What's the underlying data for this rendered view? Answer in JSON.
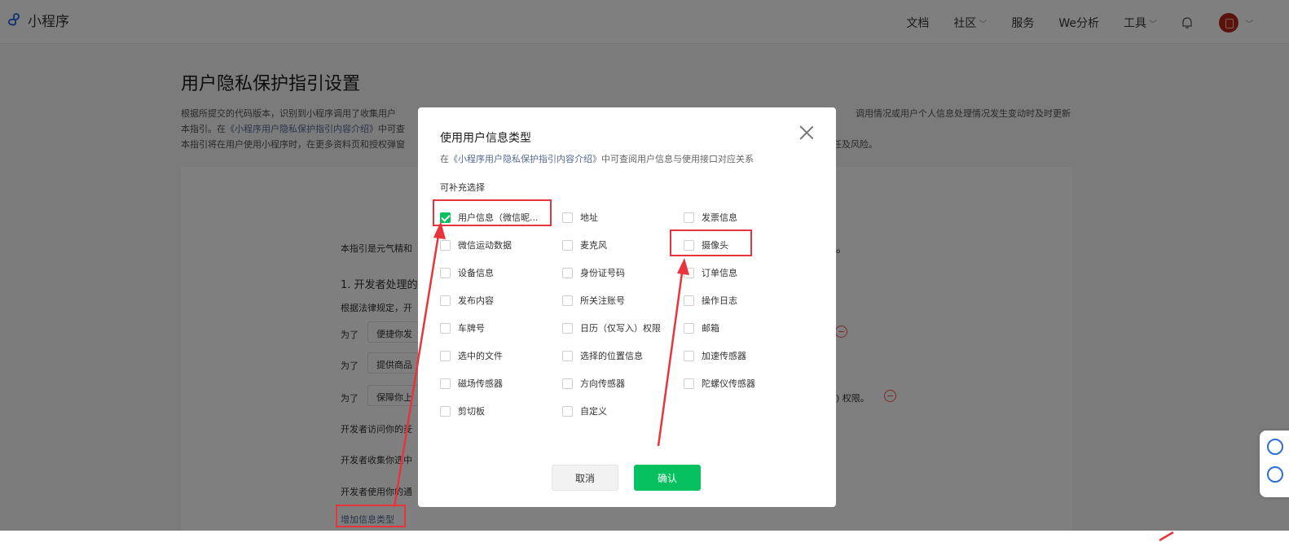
{
  "topbar": {
    "app_name": "小程序",
    "nav": {
      "docs": "文档",
      "community": "社区",
      "services": "服务",
      "we_analysis": "We分析",
      "tools": "工具"
    }
  },
  "page": {
    "title": "用户隐私保护指引设置",
    "desc_1_left": "根据所提交的代码版本，识别到小程序调用了收集用户",
    "desc_1_right": "调用情况或用户个人信息处理情况发生变动时及时更新",
    "desc_2_left": "本指引。在",
    "desc_2_link": "《小程序用户隐私保护指引内容介绍》",
    "desc_2_mid": "中可查",
    "desc_3_left": "本指引将在用户使用小程序时，在更多资料页和授权弹窗",
    "desc_3_right": "任及风险。"
  },
  "background": {
    "intro_left": "本指引是元气精和",
    "intro_right": "。",
    "section_1": "1. 开发者处理的",
    "law_text": "根据法律规定，开",
    "purpose_label": "为了",
    "purpose_1": "便捷你发",
    "purpose_2": "提供商品",
    "purpose_3": "保障你上",
    "purpose_3_suffix": ") 权限。",
    "line_access": "开发者访问你的麦",
    "line_collect": "开发者收集你选中",
    "line_use": "开发者使用你的通",
    "add_type": "增加信息类型"
  },
  "dialog": {
    "title": "使用用户信息类型",
    "hint_prefix": "在",
    "hint_link": "《小程序用户隐私保护指引内容介绍》",
    "hint_suffix": "中可查阅用户信息与使用接口对应关系",
    "section_label": "可补充选择",
    "options": [
      {
        "label": "用户信息（微信昵...",
        "checked": true
      },
      {
        "label": "地址",
        "checked": false
      },
      {
        "label": "发票信息",
        "checked": false
      },
      {
        "label": "微信运动数据",
        "checked": false
      },
      {
        "label": "麦克风",
        "checked": false
      },
      {
        "label": "摄像头",
        "checked": false
      },
      {
        "label": "设备信息",
        "checked": false
      },
      {
        "label": "身份证号码",
        "checked": false
      },
      {
        "label": "订单信息",
        "checked": false
      },
      {
        "label": "发布内容",
        "checked": false
      },
      {
        "label": "所关注账号",
        "checked": false
      },
      {
        "label": "操作日志",
        "checked": false
      },
      {
        "label": "车牌号",
        "checked": false
      },
      {
        "label": "日历（仅写入）权限",
        "checked": false
      },
      {
        "label": "邮箱",
        "checked": false
      },
      {
        "label": "选中的文件",
        "checked": false
      },
      {
        "label": "选择的位置信息",
        "checked": false
      },
      {
        "label": "加速传感器",
        "checked": false
      },
      {
        "label": "磁场传感器",
        "checked": false
      },
      {
        "label": "方向传感器",
        "checked": false
      },
      {
        "label": "陀螺仪传感器",
        "checked": false
      },
      {
        "label": "剪切板",
        "checked": false
      },
      {
        "label": "自定义",
        "checked": false
      }
    ],
    "cancel_label": "取消",
    "confirm_label": "确认"
  },
  "icons": [
    "logo-icon",
    "chevron-down-icon",
    "bell-icon",
    "avatar",
    "close-icon",
    "checkbox-icon",
    "minus-circle-icon"
  ],
  "colors": {
    "accent_green": "#07c160",
    "link_blue": "#576b95",
    "annotation_red": "#e8343c",
    "remove_red": "#fa5151"
  }
}
